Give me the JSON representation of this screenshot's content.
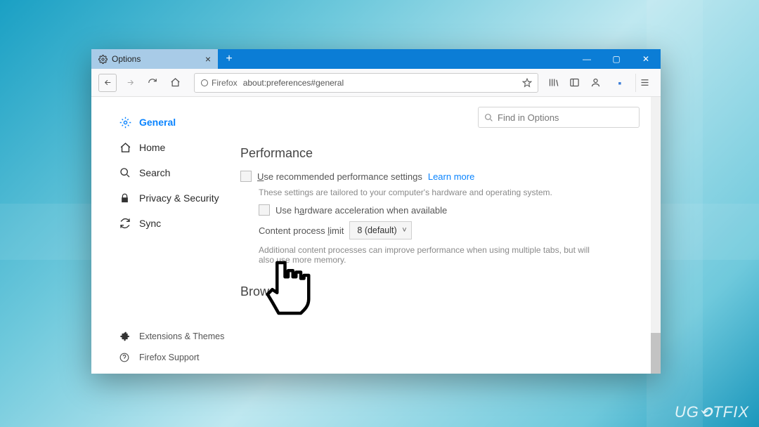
{
  "desktop": {
    "watermark": "UG⟲TFIX"
  },
  "window_controls": {
    "min": "—",
    "max": "▢",
    "close": "✕"
  },
  "tab": {
    "title": "Options",
    "close": "×",
    "new": "+"
  },
  "nav": {
    "url_prefix": "Firefox",
    "url": "about:preferences#general"
  },
  "search": {
    "placeholder": "Find in Options"
  },
  "sidebar": {
    "items": [
      {
        "icon": "⚙",
        "label": "General",
        "active": true
      },
      {
        "icon": "⌂",
        "label": "Home",
        "active": false
      },
      {
        "icon": "🔍",
        "label": "Search",
        "active": false
      },
      {
        "icon": "🔒",
        "label": "Privacy & Security",
        "active": false
      },
      {
        "icon": "🔄",
        "label": "Sync",
        "active": false
      }
    ],
    "footer": [
      {
        "icon": "✦",
        "label": "Extensions & Themes"
      },
      {
        "icon": "?",
        "label": "Firefox Support"
      }
    ]
  },
  "main": {
    "section1": "Performance",
    "opt1_pre": "U",
    "opt1_rest": "se recommended performance settings",
    "learn": "Learn more",
    "muted1": "These settings are tailored to your computer's hardware and operating system.",
    "opt2_a": "Use h",
    "opt2_u": "a",
    "opt2_b": "rdware acceleration when available",
    "proc_a": "Content process ",
    "proc_u": "l",
    "proc_b": "imit",
    "select": "8 (default)",
    "muted2": "Additional content processes can improve performance when using multiple tabs, but will also use more memory.",
    "section2": "Browsing"
  }
}
